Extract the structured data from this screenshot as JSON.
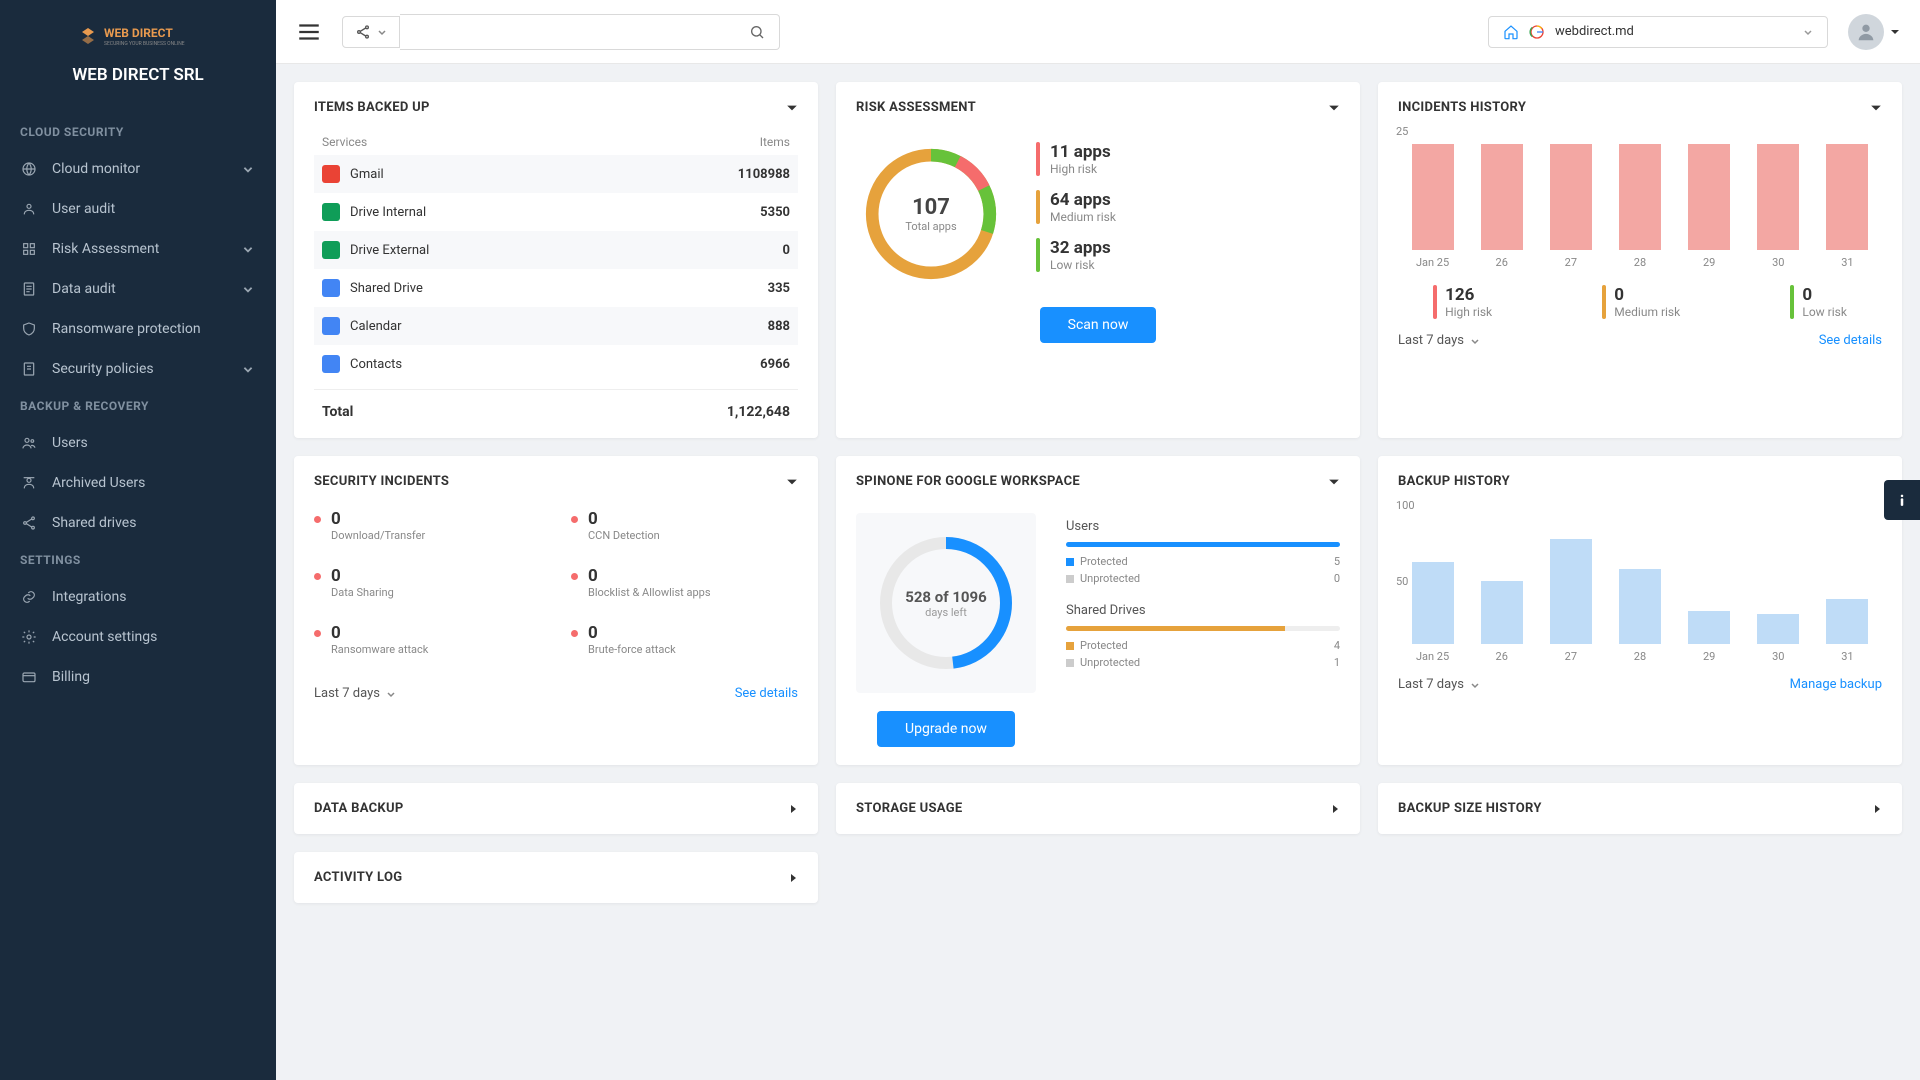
{
  "company": "WEB DIRECT SRL",
  "sidebar": {
    "sections": [
      {
        "label": "CLOUD SECURITY",
        "items": [
          {
            "label": "Cloud monitor",
            "icon": "globe",
            "expand": true
          },
          {
            "label": "User audit",
            "icon": "user"
          },
          {
            "label": "Risk Assessment",
            "icon": "grid",
            "expand": true
          },
          {
            "label": "Data audit",
            "icon": "doc",
            "expand": true
          },
          {
            "label": "Ransomware protection",
            "icon": "shield"
          },
          {
            "label": "Security policies",
            "icon": "file",
            "expand": true
          }
        ]
      },
      {
        "label": "BACKUP & RECOVERY",
        "items": [
          {
            "label": "Users",
            "icon": "users"
          },
          {
            "label": "Archived Users",
            "icon": "archive"
          },
          {
            "label": "Shared drives",
            "icon": "share"
          }
        ]
      },
      {
        "label": "SETTINGS",
        "items": [
          {
            "label": "Integrations",
            "icon": "link"
          },
          {
            "label": "Account settings",
            "icon": "gear"
          },
          {
            "label": "Billing",
            "icon": "card"
          }
        ]
      }
    ]
  },
  "topbar": {
    "domain": "webdirect.md"
  },
  "items_backed_up": {
    "title": "ITEMS BACKED UP",
    "head_svc": "Services",
    "head_cnt": "Items",
    "rows": [
      {
        "svc": "Gmail",
        "cnt": "1108988",
        "color": "#ea4335"
      },
      {
        "svc": "Drive Internal",
        "cnt": "5350",
        "color": "#0f9d58"
      },
      {
        "svc": "Drive External",
        "cnt": "0",
        "color": "#0f9d58"
      },
      {
        "svc": "Shared Drive",
        "cnt": "335",
        "color": "#4285f4"
      },
      {
        "svc": "Calendar",
        "cnt": "888",
        "color": "#4285f4"
      },
      {
        "svc": "Contacts",
        "cnt": "6966",
        "color": "#4285f4"
      }
    ],
    "total_label": "Total",
    "total_value": "1,122,648"
  },
  "risk": {
    "title": "RISK ASSESSMENT",
    "total": "107",
    "total_label": "Total apps",
    "items": [
      {
        "val": "11 apps",
        "lab": "High risk",
        "color": "#f56c6c"
      },
      {
        "val": "64 apps",
        "lab": "Medium risk",
        "color": "#e6a23c"
      },
      {
        "val": "32 apps",
        "lab": "Low risk",
        "color": "#67c23a"
      }
    ],
    "btn": "Scan now"
  },
  "incidents_history": {
    "title": "INCIDENTS HISTORY",
    "ymax": "25",
    "summary": [
      {
        "v": "126",
        "l": "High risk",
        "c": "#f56c6c"
      },
      {
        "v": "0",
        "l": "Medium risk",
        "c": "#e6a23c"
      },
      {
        "v": "0",
        "l": "Low risk",
        "c": "#67c23a"
      }
    ],
    "filter": "Last 7 days",
    "link": "See details"
  },
  "security_incidents": {
    "title": "SECURITY INCIDENTS",
    "cells": [
      {
        "v": "0",
        "l": "Download/Transfer"
      },
      {
        "v": "0",
        "l": "CCN Detection"
      },
      {
        "v": "0",
        "l": "Data Sharing"
      },
      {
        "v": "0",
        "l": "Blocklist & Allowlist apps"
      },
      {
        "v": "0",
        "l": "Ransomware attack"
      },
      {
        "v": "0",
        "l": "Brute-force attack"
      }
    ],
    "filter": "Last 7 days",
    "link": "See details"
  },
  "spinone": {
    "title": "SPINONE FOR GOOGLE WORKSPACE",
    "days": "528 of 1096",
    "days_label": "days left",
    "btn": "Upgrade now",
    "users": {
      "title": "Users",
      "protected": "Protected",
      "pval": "5",
      "unprotected": "Unprotected",
      "uval": "0"
    },
    "drives": {
      "title": "Shared Drives",
      "protected": "Protected",
      "pval": "4",
      "unprotected": "Unprotected",
      "uval": "1"
    }
  },
  "backup_history": {
    "title": "BACKUP HISTORY",
    "y100": "100",
    "y50": "50",
    "filter": "Last 7 days",
    "link": "Manage backup"
  },
  "coll": {
    "data_backup": "DATA BACKUP",
    "storage_usage": "STORAGE USAGE",
    "backup_size": "BACKUP SIZE HISTORY",
    "activity_log": "ACTIVITY LOG"
  },
  "chart_data": [
    {
      "type": "bar",
      "title": "Incidents History",
      "categories": [
        "Jan 25",
        "26",
        "27",
        "28",
        "29",
        "30",
        "31"
      ],
      "values": [
        22,
        22,
        22,
        22,
        22,
        22,
        22
      ],
      "ylim": [
        0,
        25
      ],
      "color": "#f3a7a3"
    },
    {
      "type": "bar",
      "title": "Backup History",
      "categories": [
        "Jan 25",
        "26",
        "27",
        "28",
        "29",
        "30",
        "31"
      ],
      "values": [
        55,
        42,
        70,
        50,
        22,
        20,
        30
      ],
      "ylim": [
        0,
        100
      ],
      "color": "#bfdcf7"
    },
    {
      "type": "pie",
      "title": "Risk Assessment",
      "series": [
        {
          "name": "High risk",
          "value": 11,
          "color": "#f56c6c"
        },
        {
          "name": "Medium risk",
          "value": 64,
          "color": "#e6a23c"
        },
        {
          "name": "Low risk",
          "value": 32,
          "color": "#67c23a"
        }
      ],
      "total": 107
    },
    {
      "type": "pie",
      "title": "SpinOne days",
      "series": [
        {
          "name": "Days left",
          "value": 528
        },
        {
          "name": "Elapsed",
          "value": 568
        }
      ],
      "total": 1096
    }
  ]
}
